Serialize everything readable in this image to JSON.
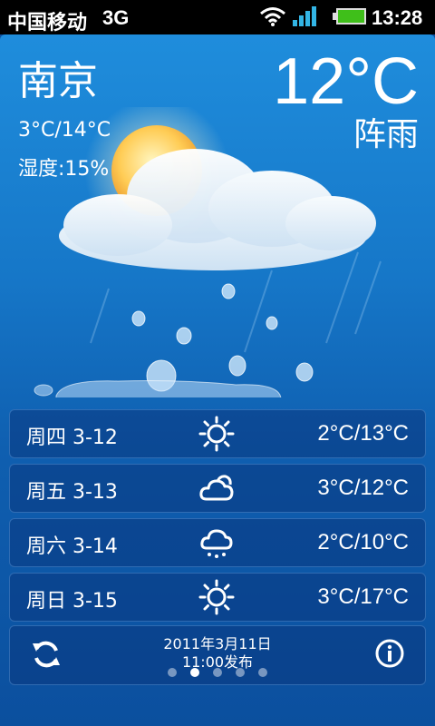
{
  "status_bar": {
    "carrier": "中国移动",
    "network": "3G",
    "time": "13:28"
  },
  "current": {
    "city": "南京",
    "temp_range": "3°C/14°C",
    "humidity": "湿度:15%",
    "temperature": "12°C",
    "condition": "阵雨",
    "scene_icon": "partly-cloudy-rain"
  },
  "forecast": [
    {
      "day": "周四 3-12",
      "icon": "sun-icon",
      "temp": "2°C/13°C"
    },
    {
      "day": "周五 3-13",
      "icon": "cloud-icon",
      "temp": "3°C/12°C"
    },
    {
      "day": "周六 3-14",
      "icon": "rain-cloud-icon",
      "temp": "2°C/10°C"
    },
    {
      "day": "周日 3-15",
      "icon": "sun-icon",
      "temp": "3°C/17°C"
    }
  ],
  "footer": {
    "publish_date": "2011年3月11日",
    "publish_time": "11:00发布"
  },
  "pager": {
    "count": 5,
    "active_index": 1
  },
  "colors": {
    "accent": "#ffffff",
    "bg_top": "#1f8ddc",
    "bg_bottom": "#0b4f9e",
    "panel": "#0a377d"
  }
}
